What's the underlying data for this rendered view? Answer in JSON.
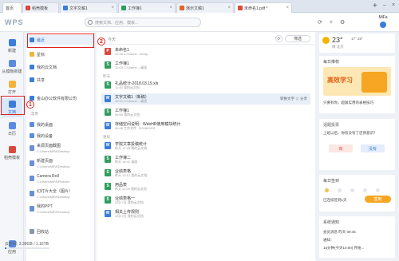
{
  "tabs": [
    {
      "label": "首页",
      "color": "#3b6fd6"
    },
    {
      "label": "稻壳模板",
      "color": "#d94a3d"
    },
    {
      "label": "文字文稿1",
      "color": "#3b7dd8"
    },
    {
      "label": "工作簿1",
      "color": "#2f9d5d"
    },
    {
      "label": "演示文稿1",
      "color": "#e0632e"
    },
    {
      "label": "未命名1.pdf *",
      "color": "#d94a3d"
    }
  ],
  "topbar": {
    "logo": "WPS",
    "search_placeholder": "搜索文档、应用、模板...",
    "user_name": "MiFa"
  },
  "leftnav": [
    {
      "label": "新建",
      "color": "#3b7dd8"
    },
    {
      "label": "从模板新建",
      "color": "#3b7dd8"
    },
    {
      "label": "打开",
      "color": "#f2b43c"
    },
    {
      "label": "文档",
      "color": "#3b7dd8"
    },
    {
      "label": "日历",
      "color": "#5a8be0"
    },
    {
      "label": "稻壳模板",
      "color": "#d94a3d"
    },
    {
      "label": "应用",
      "color": "#5a8be0"
    }
  ],
  "sidebar": {
    "items": [
      {
        "label": "最近",
        "color": "#3b7dd8"
      },
      {
        "label": "星标",
        "color": "#f2b43c"
      },
      {
        "label": "我的云文档",
        "color": "#3b7dd8"
      },
      {
        "label": "共享",
        "color": "#3b7dd8"
      },
      {
        "label": "金山办公软件有限公司",
        "color": "#3b7dd8"
      },
      {
        "label": "我的桌面",
        "color": "#5a8be0"
      },
      {
        "label": "我的设备",
        "color": "#5a8be0"
      }
    ],
    "section_label": "常用",
    "files": [
      {
        "name": "来源页面截图",
        "path": "C:\\Users\\MiFA\\Desktop"
      },
      {
        "name": "新建页面",
        "path": "C:\\Users\\MiFA\\Desktop"
      },
      {
        "name": "Camera Roll",
        "path": "C:\\Users\\MiFA\\Pictures"
      },
      {
        "name": "幻灯片大全（图片）",
        "path": "C:\\Users\\MiFA\\Desktop"
      },
      {
        "name": "我的PPT",
        "path": "C:\\Users\\MiFA\\Desktop"
      }
    ],
    "recycle": "回收站",
    "space_label": "云空间: 3.39GB / 1.16TB",
    "space_fraction": 0.03
  },
  "main": {
    "header_label": "今天",
    "filter_label": "筛选",
    "groups": [
      "今天",
      "昨天",
      "更早"
    ],
    "files": [
      {
        "name": "未命名1",
        "meta": "12:18  C:\\Users\\...\\temp",
        "icon": "P",
        "color": "#d94a3d"
      },
      {
        "name": "工作簿1",
        "meta": "12:09  C:\\Users\\...\\桌面",
        "icon": "S",
        "color": "#2f9d5d"
      },
      {
        "name": "礼品统计-2018.03.19.xls",
        "meta": "11:45  我的云文档",
        "icon": "S",
        "color": "#2f9d5d"
      },
      {
        "name": "文字文稿1（新稿）",
        "meta": "10:21  C:\\Users\\...\\桌面",
        "icon": "W",
        "color": "#3b7dd8",
        "actions": "转换文字  ☆  分享",
        "highlight": true
      },
      {
        "name": "工作簿1",
        "meta": "09:50  我的云文档",
        "icon": "S",
        "color": "#2f9d5d"
      },
      {
        "name": "存储空间说明：WebHR使用模块统计",
        "meta": "09:48  工作文件（20180319）",
        "icon": "W",
        "color": "#3b7dd8"
      },
      {
        "name": "学院文章投稿统计",
        "meta": "昨天 17:03  我的云文档",
        "icon": "W",
        "color": "#3b7dd8"
      },
      {
        "name": "工作簿二",
        "meta": "昨天 16:41  桌面",
        "icon": "S",
        "color": "#2f9d5d"
      },
      {
        "name": "业绩表格",
        "meta": "昨天 14:12  我的云文档",
        "icon": "S",
        "color": "#2f9d5d"
      },
      {
        "name": "用品表",
        "meta": "昨天 11:09  我的云文档",
        "icon": "S",
        "color": "#2f9d5d"
      },
      {
        "name": "业绩表格一",
        "meta": "3月17日  我的云文档",
        "icon": "S",
        "color": "#2f9d5d"
      },
      {
        "name": "相关上传规则",
        "meta": "3月17日  我的云文档",
        "icon": "W",
        "color": "#3b7dd8"
      }
    ]
  },
  "right": {
    "weather_temp": "23°",
    "weather_range": "17° 28°",
    "weather_cond": "晴  北京",
    "ad_title": "每日推荐",
    "ad_banner": "高效学习",
    "ad_desc": "只要有你，超级实用的表格技巧",
    "vote_title": "话题投票",
    "vote_q": "上班以后，你有没有了还债意识？",
    "vote_yes": "有",
    "vote_no": "没有",
    "checkin_title": "每日签到",
    "checkin_desc": "已连续签到1天",
    "checkin_btn": "签到",
    "msg_title": "系统通知",
    "msg_line1": "会员消息    昨天 09:45",
    "msg_line2": "通知：",
    "msg_line3": "15分钟(今天10:00) 开始..."
  },
  "annotations": [
    "1",
    "2"
  ]
}
